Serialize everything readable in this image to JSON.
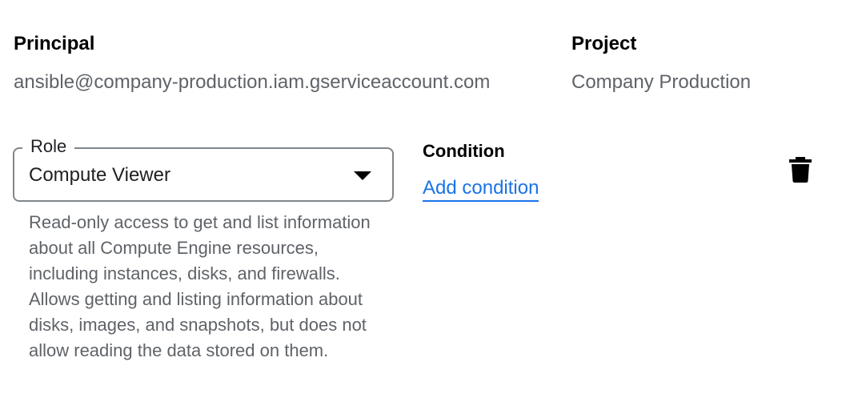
{
  "principal": {
    "label": "Principal",
    "value": "ansible@company-production.iam.gserviceaccount.com"
  },
  "project": {
    "label": "Project",
    "value": "Company Production"
  },
  "role": {
    "label": "Role",
    "selected": "Compute Viewer",
    "description": "Read-only access to get and list information about all Compute Engine resources, including instances, disks, and firewalls. Allows getting and listing information about disks, images, and snapshots, but does not allow reading the data stored on them."
  },
  "condition": {
    "label": "Condition",
    "add_link": "Add condition"
  },
  "icons": {
    "dropdown": "chevron-down-icon",
    "delete": "trash-icon"
  },
  "colors": {
    "link": "#1a73e8",
    "muted_text": "#5f6368",
    "field_border": "#80868b"
  }
}
